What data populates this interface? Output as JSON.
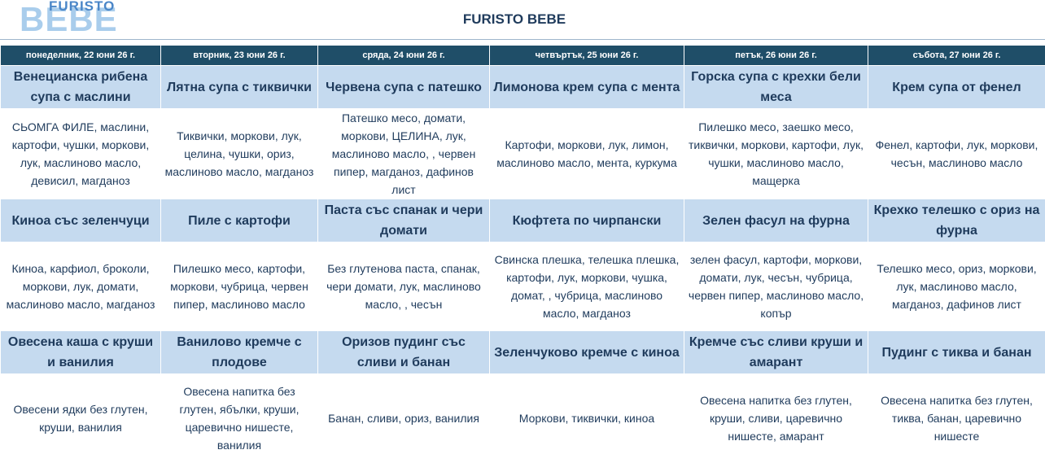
{
  "logo": {
    "top": "FURISTO",
    "bottom": "BEBE"
  },
  "title": "FURISTO BEBE",
  "days": [
    "понеделник, 22 юни 26 г.",
    "вторник, 23 юни 26 г.",
    "сряда, 24 юни 26 г.",
    "четвъртък, 25 юни 26 г.",
    "петък, 26 юни 26 г.",
    "събота, 27 юни 26 г."
  ],
  "rows": [
    {
      "dishes": [
        "Венецианска рибена супа с маслини",
        "Лятна супа с тиквички",
        "Червена супа с патешко",
        "Лимонова крем супа с мента",
        "Горска супа с крехки бели меса",
        "Крем супа от фенел"
      ],
      "ingredients": [
        "СЬОМГА ФИЛЕ, маслини, картофи, чушки, моркови, лук, маслиново масло, девисил, магданоз",
        "Тиквички, моркови, лук, целина, чушки, ориз, маслиново масло, магданоз",
        "Патешко месо, домати, моркови, ЦЕЛИНА, лук, маслиново масло, , червен пипер, магданоз, дафинов лист",
        "Картофи, моркови, лук, лимон, маслиново масло, мента, куркума",
        "Пилешко месо, заешко месо, тиквички, моркови, картофи, лук, чушки, маслиново масло, мащерка",
        "Фенел, картофи, лук, моркови, чесън,  маслиново масло"
      ]
    },
    {
      "dishes": [
        "Киноа със зеленчуци",
        "Пиле с картофи",
        "Паста със спанак и чери домати",
        "Кюфтета по чирпански",
        "Зелен фасул на фурна",
        "Крехко телешко с ориз на фурна"
      ],
      "ingredients": [
        "Киноа, карфиол, броколи, моркови, лук, домати, маслиново масло, магданоз",
        "Пилешко месо, картофи, моркови, чубрица, червен пипер, маслиново масло",
        "Без глутенова паста, спанак, чери домати, лук, маслиново масло, , чесън",
        "Свинска плешка, телешка плешка, картофи, лук, моркови, чушка, домат, , чубрица, маслиново масло, магданоз",
        "зелен фасул, картофи, моркови, домати, лук, чесън, чубрица, червен пипер, маслиново масло, копър",
        "Телешко месо, ориз, моркови, лук, маслиново масло, магданоз, дафинов лист"
      ]
    },
    {
      "dishes": [
        "Овесена каша с круши и ванилия",
        "Ванилово кремче с плодове",
        "Оризов пудинг със сливи и банан",
        "Зеленчуково кремче с киноа",
        "Кремче със сливи круши и амарант",
        "Пудинг с тиква и банан"
      ],
      "ingredients": [
        "Овесени ядки без глутен, круши, ванилия",
        "Овесена напитка без глутен, ябълки, круши, царевично нишесте, ванилия",
        "Банан, сливи, ориз, ванилия",
        "Моркови, тиквички, киноа",
        "Овесена напитка без глутен, круши, сливи, царевично нишесте, амарант",
        "Овесена напитка без глутен, тиква, банан, царевично нишесте"
      ]
    }
  ]
}
